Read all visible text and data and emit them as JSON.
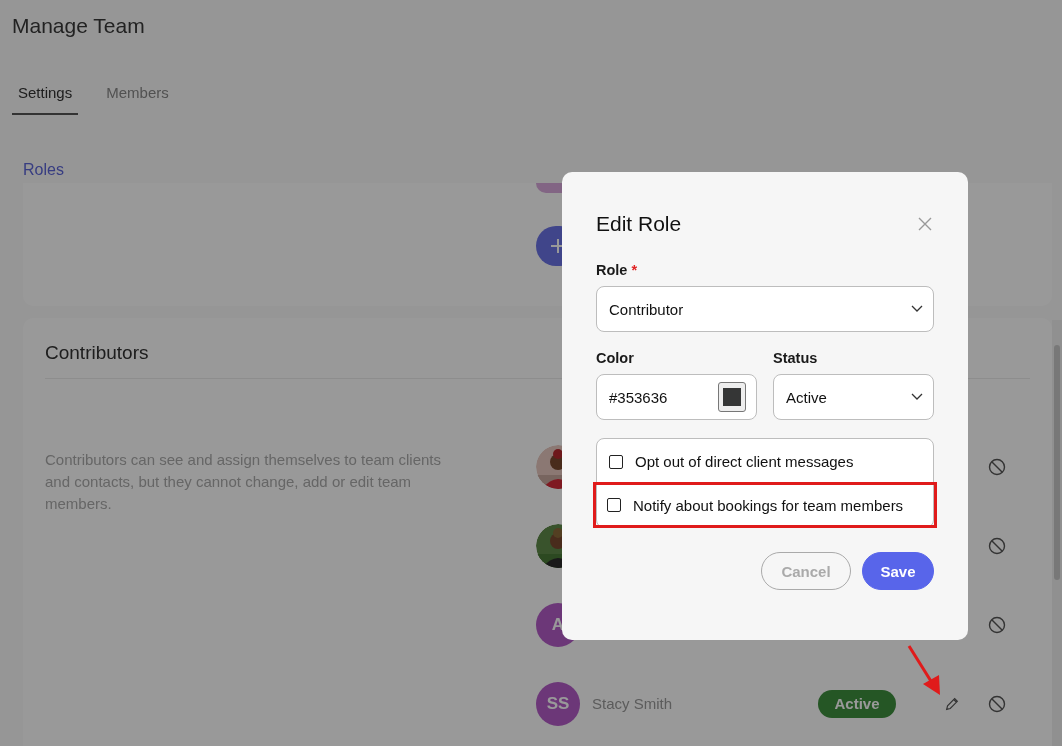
{
  "page": {
    "title": "Manage Team"
  },
  "tabs": [
    {
      "label": "Settings",
      "selected": true
    },
    {
      "label": "Members",
      "selected": false
    }
  ],
  "section_title": "Roles",
  "role_card": {
    "title": "Contributors",
    "description": "Contributors can see and assign themselves to team clients and contacts, but they cannot change, add or edit team members.",
    "members": [
      {
        "hovered": false
      },
      {
        "hovered": false
      },
      {
        "avatar": {
          "kind": "initials",
          "initials": "A"
        },
        "hovered": false
      },
      {
        "avatar": {
          "kind": "initials",
          "initials": "SS"
        },
        "name": "Stacy Smith",
        "status": "Active",
        "hovered": true
      }
    ]
  },
  "modal": {
    "title": "Edit Role",
    "fields": [
      {
        "kind": "select",
        "label": "Role",
        "required_mark": "*",
        "value": "Contributor"
      },
      {
        "kind": "color",
        "label": "Color",
        "value": "#353636",
        "color": "#353636"
      },
      {
        "kind": "select",
        "label": "Status",
        "value": "Active"
      }
    ],
    "options": [
      {
        "label": "Opt out of direct client messages",
        "checked": false,
        "highlighted": false
      },
      {
        "label": "Notify about bookings for team members",
        "checked": false,
        "highlighted": true
      }
    ],
    "buttons": [
      {
        "label": "Cancel",
        "kind": "secondary"
      },
      {
        "label": "Save",
        "kind": "primary"
      }
    ]
  }
}
